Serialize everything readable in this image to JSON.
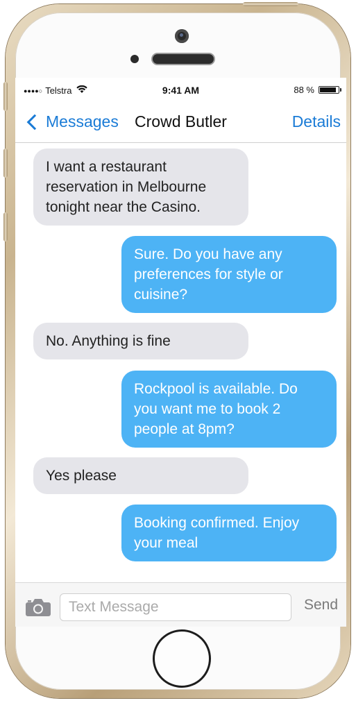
{
  "status_bar": {
    "carrier": "Telstra",
    "signal_dots": "●●●●○",
    "wifi_icon": "wifi-icon",
    "time": "9:41 AM",
    "battery_text": "88 %",
    "battery_level": 0.88
  },
  "nav": {
    "back_label": "Messages",
    "title": "Crowd Butler",
    "details_label": "Details",
    "accent_color": "#1a7bd6"
  },
  "messages": [
    {
      "sender": "user",
      "text": "I want a restaurant reservation in Melbourne tonight near the Casino."
    },
    {
      "sender": "butler",
      "text": "Sure. Do you have any preferences for style or cuisine?"
    },
    {
      "sender": "user",
      "text": "No. Anything is fine"
    },
    {
      "sender": "butler",
      "text": "Rockpool is available. Do you want me to book 2 people at 8pm?"
    },
    {
      "sender": "user",
      "text": "Yes please"
    },
    {
      "sender": "butler",
      "text": "Booking confirmed. Enjoy your meal"
    }
  ],
  "composer": {
    "placeholder": "Text Message",
    "value": "",
    "send_label": "Send",
    "camera_icon": "camera-icon"
  },
  "colors": {
    "received_bubble": "#e5e5ea",
    "sent_bubble": "#4db3f5"
  }
}
